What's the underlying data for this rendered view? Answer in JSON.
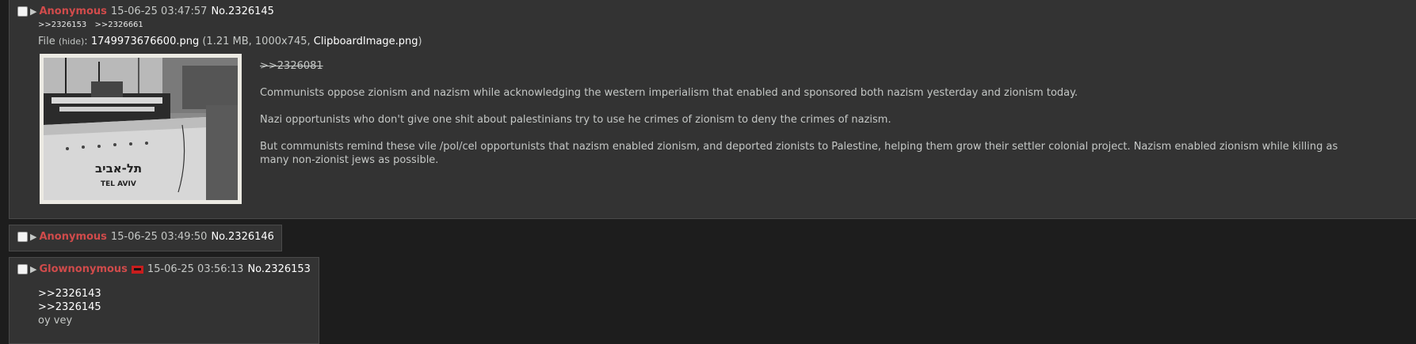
{
  "op": {
    "name": "Anonymous",
    "date": "15-06-25 03:47:57",
    "number": "No.2326145",
    "backlinks": [
      ">>2326153",
      ">>2326661"
    ],
    "file": {
      "prefix": "File",
      "hide_label": "(hide)",
      "sep": ":",
      "filename": "1749973676600.png",
      "meta": "(1.21 MB, 1000x745,",
      "original_name": "ClipboardImage.png",
      "close_paren": ")"
    },
    "thumbnail": {
      "hebrew_text": "תל-אביב",
      "ship_name": "TEL AVIV"
    },
    "quote": ">>2326081",
    "paragraphs": [
      "Communists oppose zionism and nazism while acknowledging the western imperialism that enabled and sponsored both nazism yesterday and zionism today.",
      "Nazi opportunists who don't give one shit about palestinians try to use he crimes of zionism to deny the crimes of nazism.",
      "But communists remind these vile /pol/cel opportunists that nazism enabled zionism, and deported zionists to Palestine, helping them grow their settler colonial project. Nazism enabled zionism while killing as many non-zionist jews as possible."
    ]
  },
  "replies": [
    {
      "name": "Anonymous",
      "date": "15-06-25 03:49:50",
      "number": "No.2326146"
    },
    {
      "name": "Glownonymous",
      "date": "15-06-25 03:56:13",
      "number": "No.2326153",
      "quotes": [
        ">>2326143",
        ">>2326145"
      ],
      "text": "oy vey"
    }
  ],
  "colors": {
    "name": "#d04b4b",
    "background": "#1d1d1d",
    "post_background": "#333333",
    "text": "#c5c8c6"
  }
}
